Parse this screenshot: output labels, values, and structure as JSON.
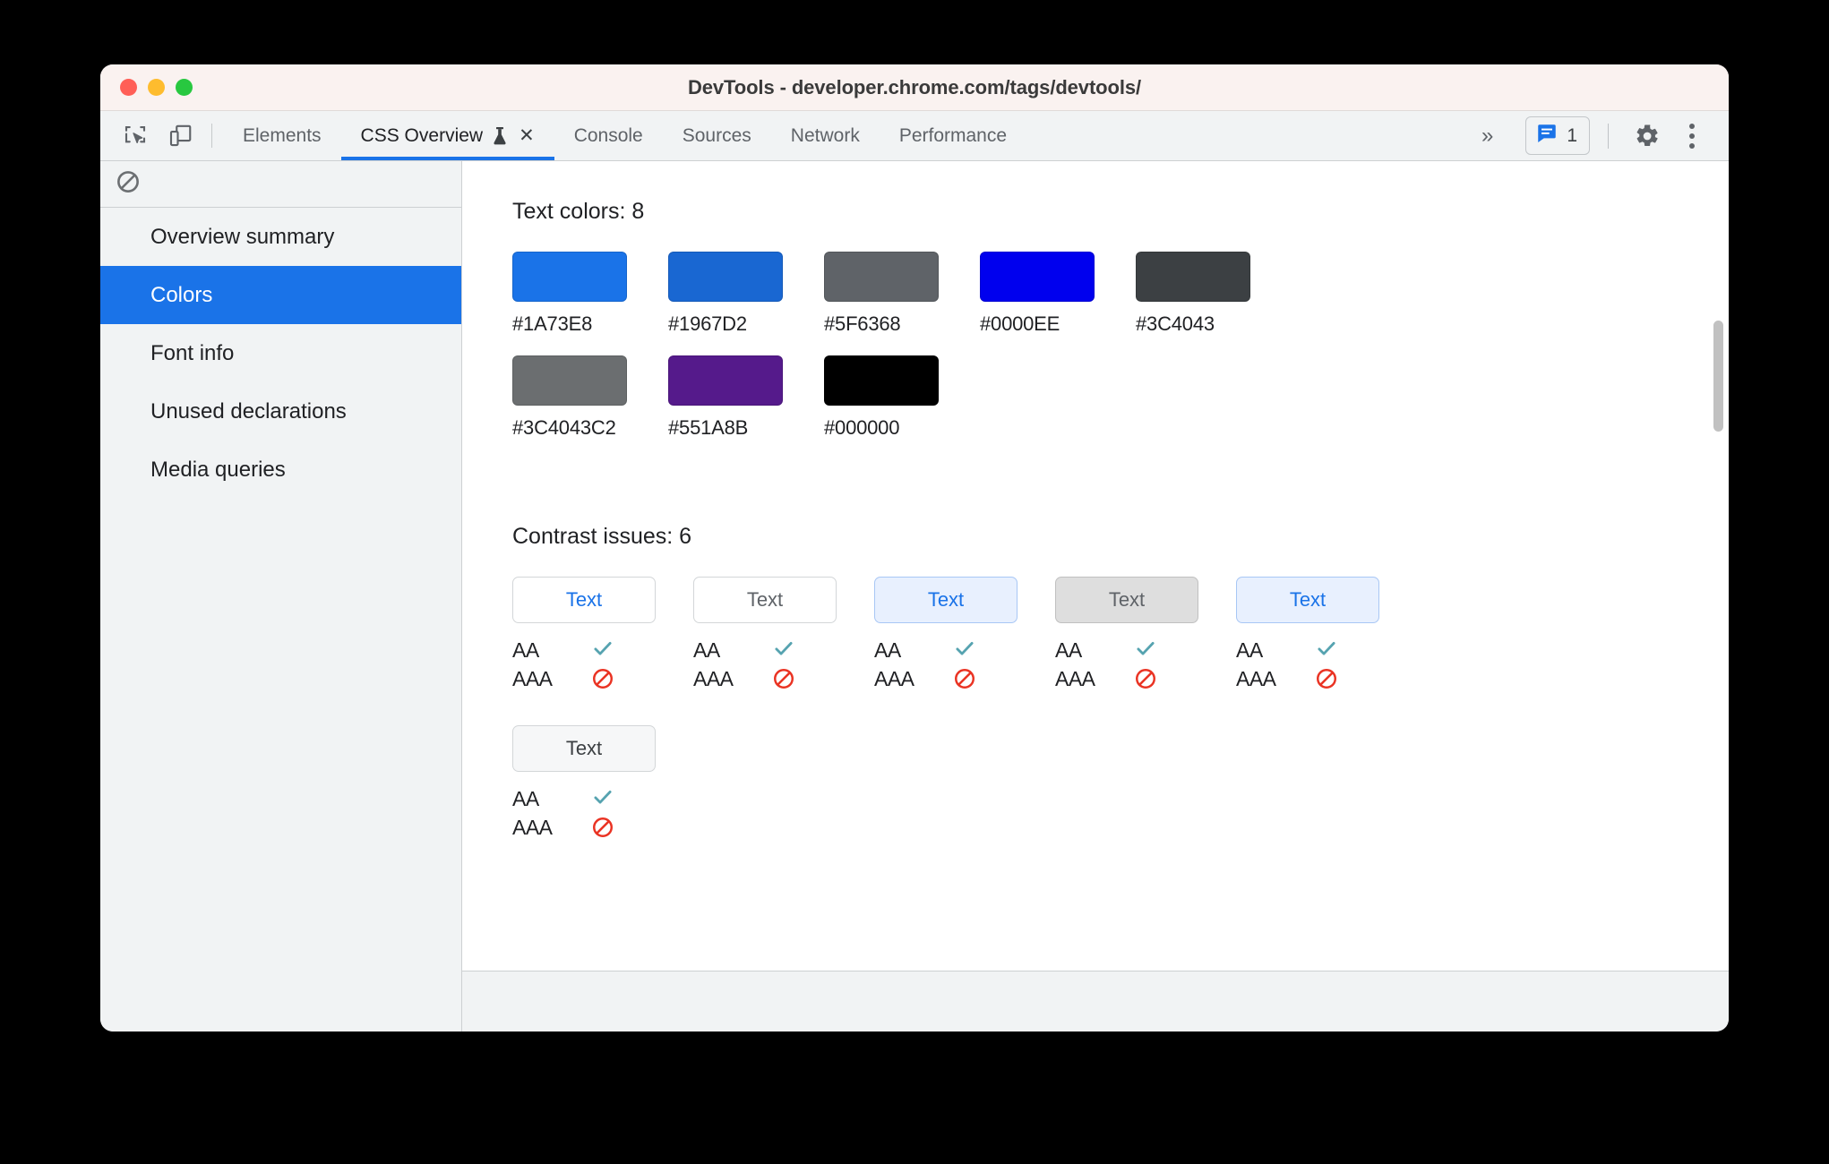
{
  "window": {
    "title": "DevTools - developer.chrome.com/tags/devtools/",
    "controls": {
      "close": "close",
      "minimize": "minimize",
      "maximize": "maximize"
    }
  },
  "toolbar": {
    "inspect_icon": "inspect-element-icon",
    "device_icon": "device-toolbar-icon",
    "overflow_label": "»",
    "issues_icon": "issues-message-icon",
    "issues_count": "1",
    "settings_icon": "gear-icon",
    "more_icon": "more-vertical-icon"
  },
  "tabs": [
    {
      "label": "Elements",
      "selected": false,
      "closable": false
    },
    {
      "label": "CSS Overview",
      "selected": true,
      "closable": true,
      "experiment_icon": "flask-icon",
      "close_label": "✕"
    },
    {
      "label": "Console",
      "selected": false,
      "closable": false
    },
    {
      "label": "Sources",
      "selected": false,
      "closable": false
    },
    {
      "label": "Network",
      "selected": false,
      "closable": false
    },
    {
      "label": "Performance",
      "selected": false,
      "closable": false
    }
  ],
  "sidebar": {
    "clear_icon": "block-clear-icon",
    "items": [
      {
        "label": "Overview summary",
        "active": false
      },
      {
        "label": "Colors",
        "active": true
      },
      {
        "label": "Font info",
        "active": false
      },
      {
        "label": "Unused declarations",
        "active": false
      },
      {
        "label": "Media queries",
        "active": false
      }
    ]
  },
  "main": {
    "text_colors": {
      "title": "Text colors: 8",
      "count": 8,
      "swatches": [
        {
          "hex": "#1A73E8"
        },
        {
          "hex": "#1967D2"
        },
        {
          "hex": "#5F6368"
        },
        {
          "hex": "#0000EE"
        },
        {
          "hex": "#3C4043"
        },
        {
          "hex": "#3C4043C2"
        },
        {
          "hex": "#551A8B"
        },
        {
          "hex": "#000000"
        }
      ]
    },
    "contrast_issues": {
      "title": "Contrast issues: 6",
      "count": 6,
      "aa_label": "AA",
      "aaa_label": "AAA",
      "pass_icon": "checkmark-icon",
      "fail_icon": "blocked-icon",
      "items": [
        {
          "sample_text": "Text",
          "text_color": "#1A73E8",
          "bg_color": "#FFFFFF",
          "border_color": "#D3D6D8",
          "aa": "pass",
          "aaa": "fail"
        },
        {
          "sample_text": "Text",
          "text_color": "#5F6368",
          "bg_color": "#FFFFFF",
          "border_color": "#D3D6D8",
          "aa": "pass",
          "aaa": "fail"
        },
        {
          "sample_text": "Text",
          "text_color": "#1A73E8",
          "bg_color": "#E8F0FE",
          "border_color": "#A8C7F5",
          "aa": "pass",
          "aaa": "fail"
        },
        {
          "sample_text": "Text",
          "text_color": "#5F6368",
          "bg_color": "#DEDEDE",
          "border_color": "#C0C0C0",
          "aa": "pass",
          "aaa": "fail"
        },
        {
          "sample_text": "Text",
          "text_color": "#1A73E8",
          "bg_color": "#E8F0FE",
          "border_color": "#A8C7F5",
          "aa": "pass",
          "aaa": "fail"
        },
        {
          "sample_text": "Text",
          "text_color": "#3C4043",
          "bg_color": "#F6F7F8",
          "border_color": "#D3D6D8",
          "aa": "pass",
          "aaa": "fail"
        }
      ]
    }
  },
  "colors": {
    "accent": "#1A73E8",
    "pass": "#56A3B0",
    "fail": "#EA3323",
    "titlebar_bg": "#FAF2F0",
    "toolbar_bg": "#F1F3F4"
  },
  "scrollbar": {
    "thumb_color": "#C1C1C1"
  }
}
